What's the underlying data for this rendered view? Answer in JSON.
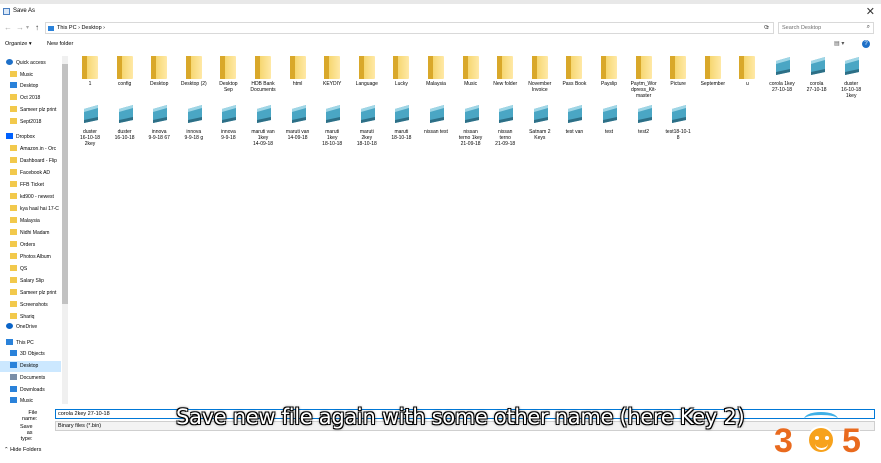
{
  "window": {
    "title": "Save As",
    "close_glyph": "✕"
  },
  "address": {
    "crumbs": "This PC  ›  Desktop  ›",
    "search_placeholder": "Search Desktop",
    "refresh_glyph": "⟳",
    "search_glyph": "⌕"
  },
  "toolbar": {
    "organize": "Organize ▾",
    "new_folder": "New folder",
    "view_glyph": "▤ ▾",
    "help_glyph": "?"
  },
  "sidebar": [
    {
      "label": "Quick access",
      "icon": "star-icon",
      "color": "#1e70c8"
    },
    {
      "label": "Music",
      "icon": "folder-icon",
      "color": "#f2c94c"
    },
    {
      "label": "Desktop",
      "icon": "desktop-icon",
      "color": "#2a82da"
    },
    {
      "label": "Oct 2018",
      "icon": "folder-icon",
      "color": "#f2c94c"
    },
    {
      "label": "Sameer plz print",
      "icon": "folder-icon",
      "color": "#f2c94c"
    },
    {
      "label": "Sept2018",
      "icon": "folder-icon",
      "color": "#f2c94c"
    },
    {
      "label": "Dropbox",
      "icon": "dropbox-icon",
      "color": "#0061fe"
    },
    {
      "label": "Amazon.in - Orc",
      "icon": "folder-icon",
      "color": "#f2c94c"
    },
    {
      "label": "Dashboard - Flip",
      "icon": "folder-icon",
      "color": "#f2c94c"
    },
    {
      "label": "Facebook AD",
      "icon": "folder-icon",
      "color": "#f2c94c"
    },
    {
      "label": "FFB Ticket",
      "icon": "folder-icon",
      "color": "#f2c94c"
    },
    {
      "label": "kd900 - newest",
      "icon": "folder-icon",
      "color": "#f2c94c"
    },
    {
      "label": "kya haal hai 17-C",
      "icon": "folder-icon",
      "color": "#f2c94c"
    },
    {
      "label": "Malaysia",
      "icon": "folder-icon",
      "color": "#f2c94c"
    },
    {
      "label": "Nidhi Madam",
      "icon": "folder-icon",
      "color": "#f2c94c"
    },
    {
      "label": "Orders",
      "icon": "folder-icon",
      "color": "#f2c94c"
    },
    {
      "label": "Photos Album",
      "icon": "folder-icon",
      "color": "#f2c94c"
    },
    {
      "label": "QS",
      "icon": "folder-icon",
      "color": "#f2c94c"
    },
    {
      "label": "Salary Slip",
      "icon": "folder-icon",
      "color": "#f2c94c"
    },
    {
      "label": "Sameer plz print",
      "icon": "folder-icon",
      "color": "#f2c94c"
    },
    {
      "label": "Screenshots",
      "icon": "folder-icon",
      "color": "#f2c94c"
    },
    {
      "label": "Shariq",
      "icon": "folder-icon",
      "color": "#f2c94c"
    },
    {
      "label": "",
      "icon": "",
      "color": ""
    },
    {
      "label": "OneDrive",
      "icon": "cloud-icon",
      "color": "#0a64c8"
    },
    {
      "label": "",
      "icon": "",
      "color": ""
    },
    {
      "label": "This PC",
      "icon": "pc-icon",
      "color": "#2a82da"
    },
    {
      "label": "3D Objects",
      "icon": "cube-icon",
      "color": "#2a82da"
    },
    {
      "label": "Desktop",
      "icon": "desktop-icon",
      "color": "#2a82da",
      "selected": true
    },
    {
      "label": "Documents",
      "icon": "documents-icon",
      "color": "#7a8ea8"
    },
    {
      "label": "Downloads",
      "icon": "download-icon",
      "color": "#2a82da"
    },
    {
      "label": "Music",
      "icon": "music-icon",
      "color": "#2a82da"
    }
  ],
  "files_row1": [
    {
      "label": "1",
      "type": "folder"
    },
    {
      "label": "config",
      "type": "folder"
    },
    {
      "label": "Desktop",
      "type": "folder"
    },
    {
      "label": "Desktop (2)",
      "type": "folder"
    },
    {
      "label": "Desktop\nSep",
      "type": "folder"
    },
    {
      "label": "HDB Bank\nDocuments",
      "type": "folder"
    },
    {
      "label": "html",
      "type": "folder"
    },
    {
      "label": "KEYDIY",
      "type": "folder"
    },
    {
      "label": "Language",
      "type": "folder"
    },
    {
      "label": "Lucky",
      "type": "folder"
    },
    {
      "label": "Malaysia",
      "type": "folder"
    },
    {
      "label": "Music",
      "type": "folder"
    },
    {
      "label": "New folder",
      "type": "folder"
    },
    {
      "label": "November\nInvoice",
      "type": "folder"
    },
    {
      "label": "Pass Book",
      "type": "folder"
    },
    {
      "label": "Payslip",
      "type": "folder"
    },
    {
      "label": "Paytm_Wor\ndpress_Kit-\nmaster",
      "type": "folder"
    },
    {
      "label": "Picture",
      "type": "folder"
    },
    {
      "label": "September",
      "type": "folder"
    },
    {
      "label": "u",
      "type": "folder"
    },
    {
      "label": "corola 1key\n27-10-18",
      "type": "bin"
    },
    {
      "label": "corola\n27-10-18",
      "type": "bin"
    },
    {
      "label": "duster\n16-10-18\n1key",
      "type": "bin"
    }
  ],
  "files_row2": [
    {
      "label": "duster\n16-10-18\n2key",
      "type": "bin"
    },
    {
      "label": "duster\n16-10-18",
      "type": "bin"
    },
    {
      "label": "innova\n9-9-18 67",
      "type": "bin"
    },
    {
      "label": "innova\n9-9-18 g",
      "type": "bin"
    },
    {
      "label": "innova\n9-9-18",
      "type": "bin"
    },
    {
      "label": "maruti van\n1key\n14-09-18",
      "type": "bin"
    },
    {
      "label": "maruti van\n14-09-18",
      "type": "bin"
    },
    {
      "label": "maruti\n1key\n18-10-18",
      "type": "bin"
    },
    {
      "label": "maruti\n2key\n18-10-18",
      "type": "bin"
    },
    {
      "label": "maruti\n18-10-18",
      "type": "bin"
    },
    {
      "label": "nissan test",
      "type": "bin"
    },
    {
      "label": "nissan\nterno 1key\n21-09-18",
      "type": "bin"
    },
    {
      "label": "nissan\nterno\n21-09-18",
      "type": "bin"
    },
    {
      "label": "Satnam 2\nKeys",
      "type": "bin"
    },
    {
      "label": "test van",
      "type": "bin"
    },
    {
      "label": "test",
      "type": "bin"
    },
    {
      "label": "test2",
      "type": "bin"
    },
    {
      "label": "test18-10-1\n8",
      "type": "bin"
    }
  ],
  "form": {
    "filename_label": "File name:",
    "filename_value": "corola 2key 27-10-18",
    "savetype_label": "Save as type:",
    "savetype_value": "Binary files (*.bin)",
    "hide_folders": "Hide Folders"
  },
  "overlay": {
    "caption": "Save new file again with some other name (here Key 2)",
    "logo_left": "3",
    "logo_right": "5"
  }
}
